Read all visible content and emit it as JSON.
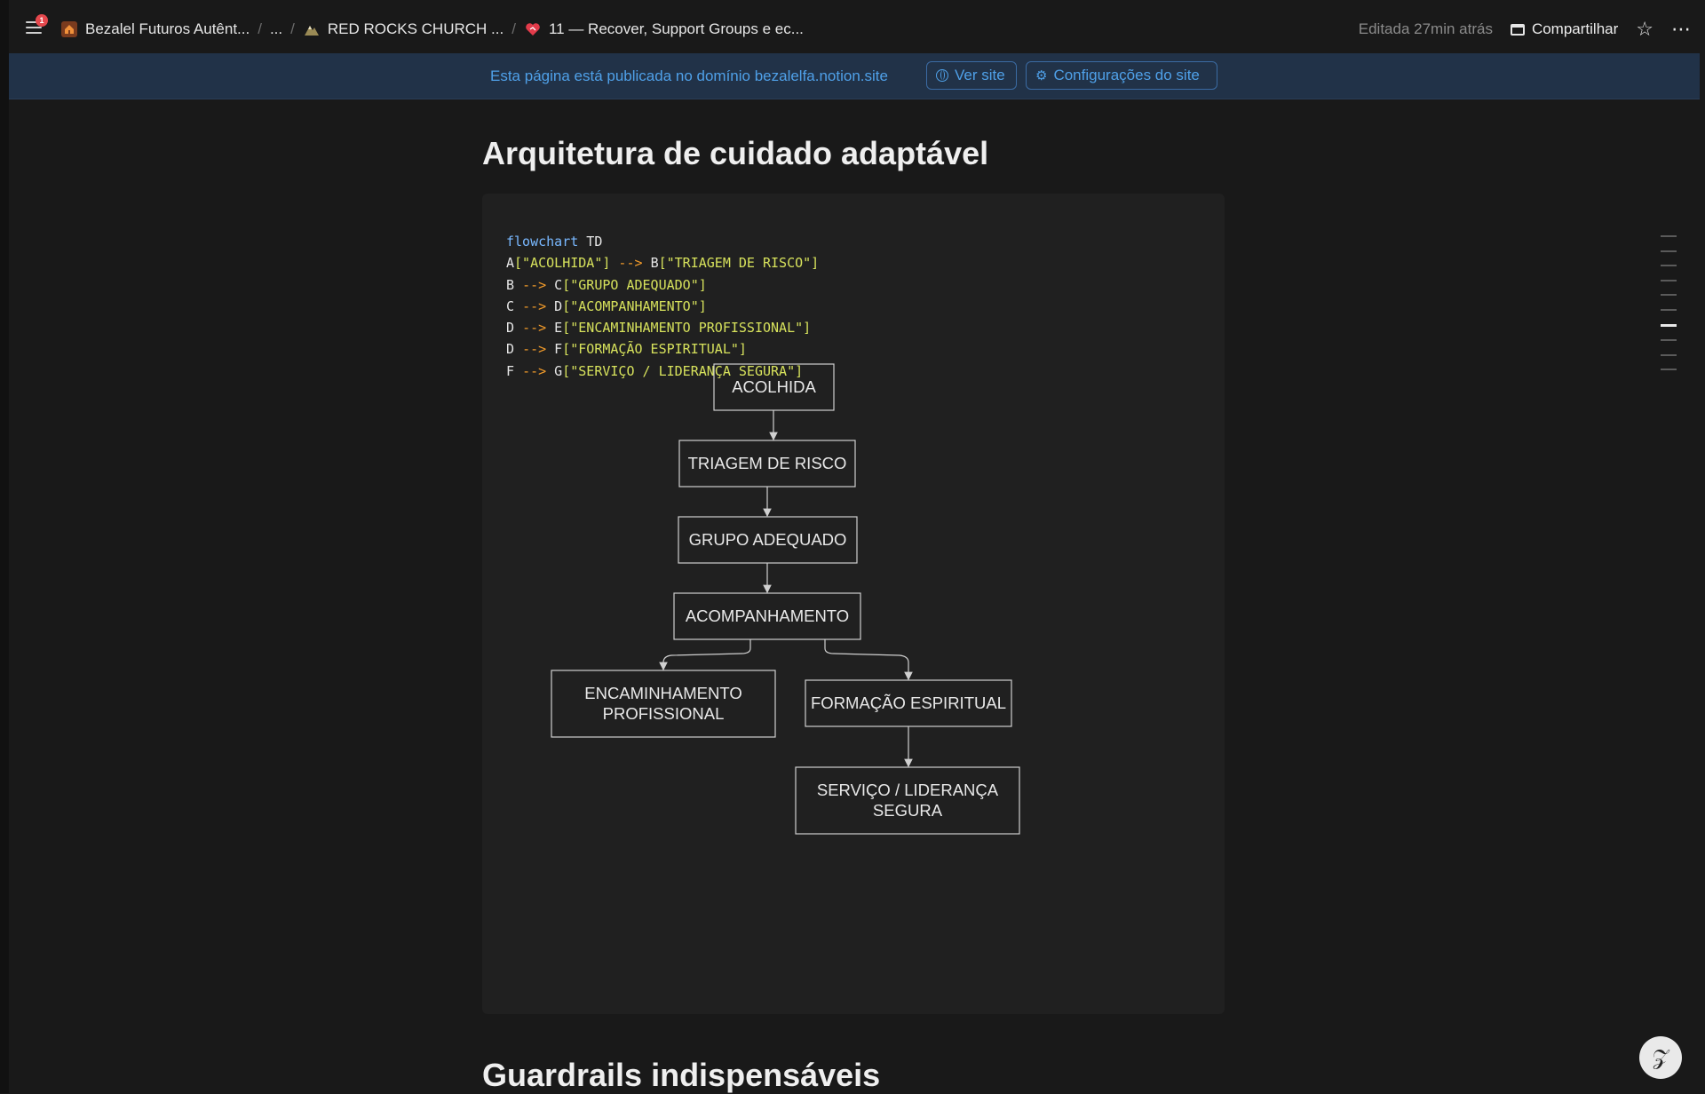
{
  "topbar": {
    "notification_count": "1",
    "breadcrumbs": [
      {
        "icon": "house-icon",
        "label": "Bezalel Futuros Autênt..."
      },
      {
        "icon": "",
        "label": "..."
      },
      {
        "icon": "mountain-icon",
        "label": "RED ROCKS CHURCH ..."
      },
      {
        "icon": "heart-icon",
        "label": "11 — Recover, Support Groups e ec..."
      }
    ],
    "edited": "Editada 27min atrás",
    "share_label": "Compartilhar"
  },
  "banner": {
    "text": "Esta página está publicada no domínio bezalelfa.notion.site",
    "view_site": "Ver site",
    "site_settings": "Configurações do site"
  },
  "page": {
    "heading": "Arquitetura de cuidado adaptável",
    "next_heading": "Guardrails indispensáveis"
  },
  "code": {
    "lines": [
      [
        {
          "t": "flowchart",
          "c": "kw"
        },
        {
          "t": " TD",
          "c": ""
        }
      ],
      [
        {
          "t": "A",
          "c": ""
        },
        {
          "t": "[\"ACOLHIDA\"]",
          "c": "str"
        },
        {
          "t": " --> ",
          "c": "arrow"
        },
        {
          "t": "B",
          "c": ""
        },
        {
          "t": "[\"TRIAGEM DE RISCO\"]",
          "c": "str"
        }
      ],
      [
        {
          "t": "B ",
          "c": ""
        },
        {
          "t": "-->",
          "c": "arrow"
        },
        {
          "t": " C",
          "c": ""
        },
        {
          "t": "[\"GRUPO ADEQUADO\"]",
          "c": "str"
        }
      ],
      [
        {
          "t": "C ",
          "c": ""
        },
        {
          "t": "-->",
          "c": "arrow"
        },
        {
          "t": " D",
          "c": ""
        },
        {
          "t": "[\"ACOMPANHAMENTO\"]",
          "c": "str"
        }
      ],
      [
        {
          "t": "D ",
          "c": ""
        },
        {
          "t": "-->",
          "c": "arrow"
        },
        {
          "t": " E",
          "c": ""
        },
        {
          "t": "[\"ENCAMINHAMENTO PROFISSIONAL\"]",
          "c": "str"
        }
      ],
      [
        {
          "t": "D ",
          "c": ""
        },
        {
          "t": "-->",
          "c": "arrow"
        },
        {
          "t": " F",
          "c": ""
        },
        {
          "t": "[\"FORMAÇÃO ESPIRITUAL\"]",
          "c": "str"
        }
      ],
      [
        {
          "t": "F ",
          "c": ""
        },
        {
          "t": "-->",
          "c": "arrow"
        },
        {
          "t": " G",
          "c": ""
        },
        {
          "t": "[\"SERVIÇO / LIDERANÇA SEGURA\"]",
          "c": "str"
        }
      ]
    ]
  },
  "flowchart": {
    "nodes": {
      "A": {
        "lines": [
          "ACOLHIDA"
        ]
      },
      "B": {
        "lines": [
          "TRIAGEM DE RISCO"
        ]
      },
      "C": {
        "lines": [
          "GRUPO ADEQUADO"
        ]
      },
      "D": {
        "lines": [
          "ACOMPANHAMENTO"
        ]
      },
      "E": {
        "lines": [
          "ENCAMINHAMENTO",
          "PROFISSIONAL"
        ]
      },
      "F": {
        "lines": [
          "FORMAÇÃO ESPIRITUAL"
        ]
      },
      "G": {
        "lines": [
          "SERVIÇO / LIDERANÇA",
          "SEGURA"
        ]
      }
    },
    "edges": [
      [
        "A",
        "B"
      ],
      [
        "B",
        "C"
      ],
      [
        "C",
        "D"
      ],
      [
        "D",
        "E"
      ],
      [
        "D",
        "F"
      ],
      [
        "F",
        "G"
      ]
    ]
  },
  "colors": {
    "background": "#191919",
    "banner_bg": "#213248",
    "link_blue": "#4fa0e8",
    "code_keyword": "#79b8ff",
    "code_string": "#d7e25c",
    "code_arrow": "#f29b2a"
  }
}
